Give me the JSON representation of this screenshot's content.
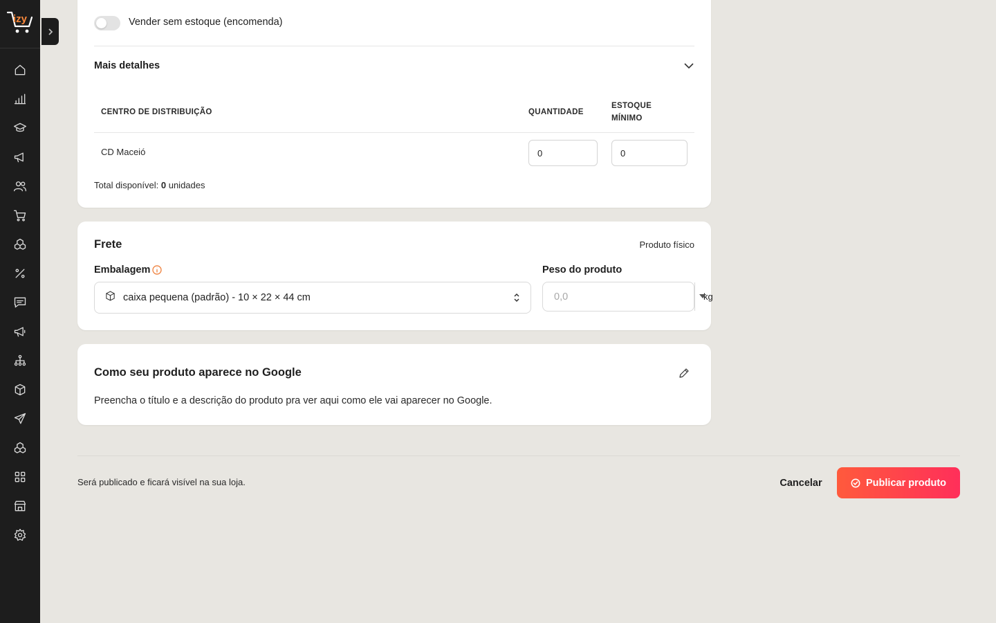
{
  "app": {
    "logo_text": "izy",
    "brand_colors": {
      "orange": "#ff5a3c",
      "pink": "#ff2f5a",
      "sidebar": "#1d1d1d",
      "background": "#e8e6e1"
    }
  },
  "sidebar": {
    "items": [
      {
        "icon": "home-icon"
      },
      {
        "icon": "bar-chart-icon"
      },
      {
        "icon": "graduation-cap-icon"
      },
      {
        "icon": "megaphone-icon"
      },
      {
        "icon": "users-icon"
      },
      {
        "icon": "cart-icon"
      },
      {
        "icon": "boxes-icon"
      },
      {
        "icon": "percent-icon"
      },
      {
        "icon": "message-icon"
      },
      {
        "icon": "megaphone-alt-icon"
      },
      {
        "icon": "hierarchy-icon"
      },
      {
        "icon": "package-icon"
      },
      {
        "icon": "send-icon"
      },
      {
        "icon": "boxes-alt-icon"
      },
      {
        "icon": "apps-grid-icon"
      },
      {
        "icon": "store-icon"
      },
      {
        "icon": "settings-icon"
      }
    ]
  },
  "stock": {
    "toggle_label": "Vender sem estoque (encomenda)",
    "toggle_on": false,
    "details_title": "Mais detalhes",
    "table": {
      "headers": [
        "CENTRO DE DISTRIBUIÇÃO",
        "QUANTIDADE",
        "ESTOQUE MÍNIMO"
      ],
      "header_min_line1": "ESTOQUE",
      "header_min_line2": "MÍNIMO",
      "rows": [
        {
          "center": "CD Maceió",
          "quantity": "0",
          "min_stock": "0"
        }
      ]
    },
    "total_prefix": "Total disponível:",
    "total_value": "0",
    "total_suffix": "unidades"
  },
  "shipping": {
    "title": "Frete",
    "product_type": "Produto físico",
    "packaging_label": "Embalagem",
    "packaging_value": "caixa pequena (padrão) - 10 × 22 × 44 cm",
    "weight_label": "Peso do produto",
    "weight_placeholder": "0,0",
    "weight_unit": "kg"
  },
  "google": {
    "title": "Como seu produto aparece no Google",
    "description": "Preencha o título e a descrição do produto pra ver aqui como ele vai aparecer no Google."
  },
  "footer": {
    "note": "Será publicado e ficará visível na sua loja.",
    "cancel_label": "Cancelar",
    "publish_label": "Publicar produto"
  }
}
